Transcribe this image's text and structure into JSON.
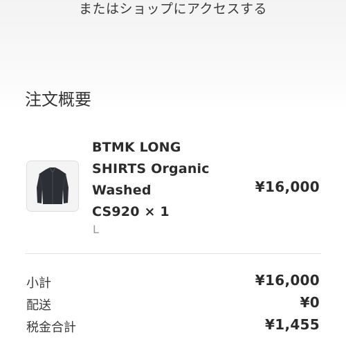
{
  "header": {
    "shop_link": "またはショップにアクセスする"
  },
  "order_summary": {
    "title": "注文概要",
    "item": {
      "name_lines": [
        "BTMK LONG",
        "SHIRTS Organic",
        "Washed",
        "CS920 × 1"
      ],
      "variant": "L",
      "price": "¥16,000",
      "thumbnail_icon": "jacket-thumbnail"
    },
    "rows": [
      {
        "label": "小計",
        "value": "¥16,000"
      },
      {
        "label": "配送",
        "value": "¥0"
      },
      {
        "label": "税金合計",
        "value": "¥1,455"
      }
    ]
  }
}
